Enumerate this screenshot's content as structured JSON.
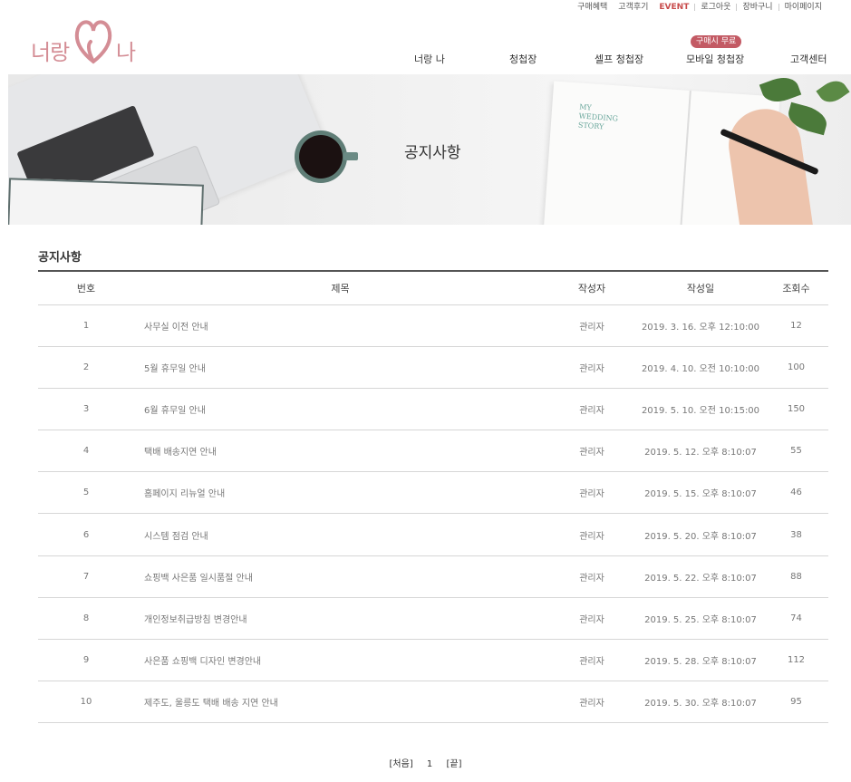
{
  "util_nav": [
    "구매혜택",
    "고객후기",
    "EVENT",
    "로그아웃",
    "장바구니",
    "마이페이지"
  ],
  "logo": {
    "left": "너랑",
    "right": "나"
  },
  "main_nav": [
    "너랑 나",
    "청첩장",
    "셀프 청첩장",
    "모바일 청첩장",
    "고객센터"
  ],
  "promo_badge": "구매시 무료",
  "banner": {
    "title": "공지사항",
    "book_text": "MY\nWEDDING\nSTORY"
  },
  "section_title": "공지사항",
  "table": {
    "headers": [
      "번호",
      "제목",
      "작성자",
      "작성일",
      "조회수"
    ],
    "rows": [
      [
        "1",
        "사무실 이전 안내",
        "관리자",
        "2019. 3. 16. 오후 12:10:00",
        "12"
      ],
      [
        "2",
        "5월 휴무일 안내",
        "관리자",
        "2019. 4. 10. 오전 10:10:00",
        "100"
      ],
      [
        "3",
        "6월 휴무일 안내",
        "관리자",
        "2019. 5. 10. 오전 10:15:00",
        "150"
      ],
      [
        "4",
        "택배 배송지연 안내",
        "관리자",
        "2019. 5. 12. 오후 8:10:07",
        "55"
      ],
      [
        "5",
        "홈페이지 리뉴얼 안내",
        "관리자",
        "2019. 5. 15. 오후 8:10:07",
        "46"
      ],
      [
        "6",
        "시스템 점검 안내",
        "관리자",
        "2019. 5. 20. 오후 8:10:07",
        "38"
      ],
      [
        "7",
        "쇼핑백 사은품 일시품절 안내",
        "관리자",
        "2019. 5. 22. 오후 8:10:07",
        "88"
      ],
      [
        "8",
        "개인정보취급방침 변경안내",
        "관리자",
        "2019. 5. 25. 오후 8:10:07",
        "74"
      ],
      [
        "9",
        "사은품 쇼핑백 디자인 변경안내",
        "관리자",
        "2019. 5. 28. 오후 8:10:07",
        "112"
      ],
      [
        "10",
        "제주도, 울릉도 택배 배송 지연 안내",
        "관리자",
        "2019. 5. 30. 오후 8:10:07",
        "95"
      ]
    ]
  },
  "pagination": {
    "first": "[처음]",
    "page": "1",
    "last": "[끝]"
  },
  "colors": {
    "brand": "#d48d95",
    "event": "#c84b4b",
    "promo": "#c35a64"
  }
}
